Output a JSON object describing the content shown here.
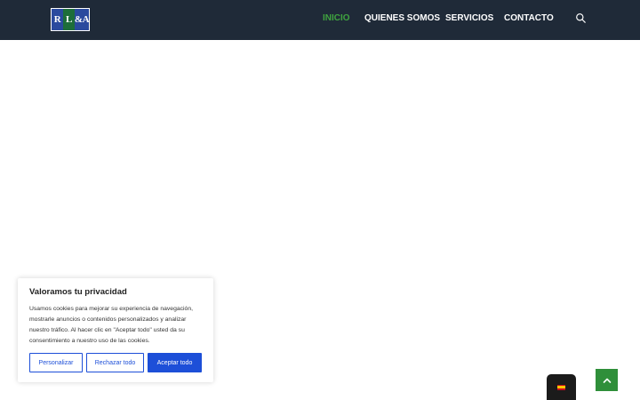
{
  "header": {
    "logo_text": "RL&A",
    "nav": [
      {
        "label": "INICIO",
        "active": true
      },
      {
        "label": "QUIENES SOMOS",
        "active": false
      },
      {
        "label": "SERVICIOS",
        "active": false
      },
      {
        "label": "CONTACTO",
        "active": false
      }
    ],
    "search_icon": "search-icon"
  },
  "cookie_banner": {
    "title": "Valoramos tu privacidad",
    "text": "Usamos cookies para mejorar su experiencia de navegación, mostrarle anuncios o contenidos personalizados y analizar nuestro tráfico. Al hacer clic en \"Aceptar todo\" usted da su consentimiento a nuestro uso de las cookies.",
    "customize_label": "Personalizar",
    "reject_label": "Rechazar todo",
    "accept_label": "Aceptar todo"
  },
  "language_switcher": {
    "icon": "spain-flag-icon"
  },
  "scroll_top": {
    "icon": "chevron-up-icon"
  },
  "colors": {
    "navbar_bg": "#1f2a38",
    "active_nav": "#3fa33f",
    "button_blue": "#1d4fd8",
    "scroll_top_bg": "#2f8f3a"
  }
}
